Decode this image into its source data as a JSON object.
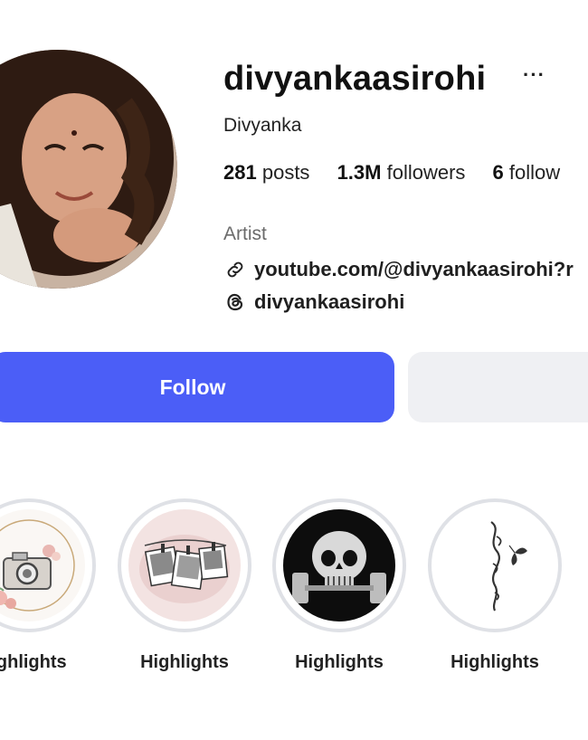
{
  "profile": {
    "username": "divyankaasirohi",
    "more_icon": "more-horizontal-icon",
    "full_name": "Divyanka",
    "category": "Artist",
    "link_text": "youtube.com/@divyankaasirohi?r",
    "link_icon": "link-icon",
    "threads_handle": "divyankaasirohi",
    "threads_icon": "threads-icon"
  },
  "stats": {
    "posts_count": "281",
    "posts_label": "posts",
    "followers_count": "1.3M",
    "followers_label": "followers",
    "following_count": "6",
    "following_label": "follow"
  },
  "actions": {
    "follow_label": "Follow",
    "follow_color": "#4b5ef7"
  },
  "highlights": [
    {
      "label": "ighlights",
      "icon": "camera-icon"
    },
    {
      "label": "Highlights",
      "icon": "photos-icon"
    },
    {
      "label": "Highlights",
      "icon": "skull-icon"
    },
    {
      "label": "Highlights",
      "icon": "blessed-script-icon"
    }
  ]
}
